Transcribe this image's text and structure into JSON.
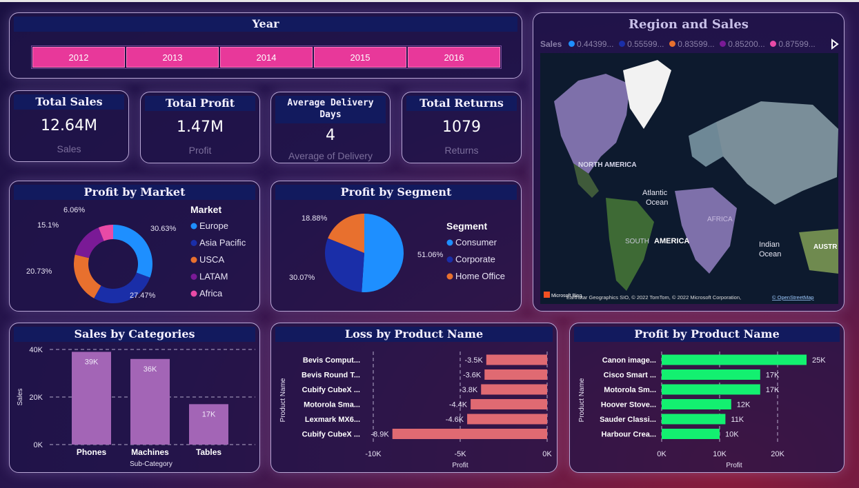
{
  "colors": {
    "slicer": "#e8389a",
    "europe": "#1e8fff",
    "asia_pacific": "#1a2ea8",
    "usca": "#e8702e",
    "latam": "#7a1a96",
    "africa": "#e84aa6",
    "category_bar": "#a365b6",
    "loss_bar": "#e06a72",
    "profit_bar": "#13f070"
  },
  "year_slicer": {
    "title": "Year",
    "years": [
      "2012",
      "2013",
      "2014",
      "2015",
      "2016"
    ]
  },
  "kpis": {
    "total_sales": {
      "title": "Total Sales",
      "value": "12.64M",
      "label": "Sales"
    },
    "total_profit": {
      "title": "Total Profit",
      "value": "1.47M",
      "label": "Profit"
    },
    "avg_delivery": {
      "title": "Average Delivery Days",
      "value": "4",
      "label": "Average of Delivery"
    },
    "total_returns": {
      "title": "Total Returns",
      "value": "1079",
      "label": "Returns"
    }
  },
  "map": {
    "title": "Region and Sales",
    "legend_title": "Sales",
    "legend_items": [
      "0.44399...",
      "0.55599...",
      "0.83599...",
      "0.85200...",
      "0.87599..."
    ],
    "legend_colors": [
      "#1e8fff",
      "#1a2ea8",
      "#e8702e",
      "#7a1a96",
      "#e84aa6"
    ],
    "labels": {
      "north_america": "NORTH AMERICA",
      "atlantic_1": "Atlantic",
      "atlantic_2": "Ocean",
      "africa": "AFRICA",
      "south_america_a": "SOUTH",
      "south_america_b": "AMERICA",
      "indian_1": "Indian",
      "indian_2": "Ocean",
      "australia": "AUSTR"
    },
    "attribution": "Microsoft Bing",
    "copyright": "Earthstar Geographics SIO, © 2022 TomTom, © 2022 Microsoft Corporation,",
    "osm_link": "© OpenStreetMap"
  },
  "chart_data": [
    {
      "type": "pie",
      "variant": "donut",
      "title": "Profit by Market",
      "legend_title": "Market",
      "legend_position": "right",
      "categories": [
        "Europe",
        "Asia Pacific",
        "USCA",
        "LATAM",
        "Africa"
      ],
      "values": [
        30.63,
        27.47,
        20.73,
        15.1,
        6.06
      ],
      "labels": [
        "30.63%",
        "27.47%",
        "20.73%",
        "15.1%",
        "6.06%"
      ]
    },
    {
      "type": "pie",
      "title": "Profit by Segment",
      "legend_title": "Segment",
      "legend_position": "right",
      "categories": [
        "Consumer",
        "Corporate",
        "Home Office"
      ],
      "values": [
        51.06,
        30.07,
        18.88
      ],
      "labels": [
        "51.06%",
        "30.07%",
        "18.88%"
      ]
    },
    {
      "type": "bar",
      "title": "Sales by Categories",
      "categories": [
        "Phones",
        "Machines",
        "Tables"
      ],
      "values": [
        39000,
        36000,
        17000
      ],
      "labels": [
        "39K",
        "36K",
        "17K"
      ],
      "xlabel": "Sub-Category",
      "ylabel": "Sales",
      "ylim": [
        0,
        40000
      ],
      "yticks": [
        "0K",
        "20K",
        "40K"
      ],
      "grid": true
    },
    {
      "type": "bar",
      "orientation": "horizontal",
      "title": "Loss by Product Name",
      "categories": [
        "Bevis Comput...",
        "Bevis Round T...",
        "Cubify CubeX ...",
        "Motorola Sma...",
        "Lexmark MX6...",
        "Cubify CubeX ..."
      ],
      "values": [
        -3500,
        -3600,
        -3800,
        -4400,
        -4600,
        -8900
      ],
      "labels": [
        "-3.5K",
        "-3.6K",
        "-3.8K",
        "-4.4K",
        "-4.6K",
        "-8.9K"
      ],
      "xlabel": "Profit",
      "ylabel": "Product Name",
      "xlim": [
        -10000,
        0
      ],
      "xticks": [
        "-10K",
        "-5K",
        "0K"
      ],
      "grid": true
    },
    {
      "type": "bar",
      "orientation": "horizontal",
      "title": "Profit by Product Name",
      "categories": [
        "Canon image...",
        "Cisco Smart ...",
        "Motorola Sm...",
        "Hoover Stove...",
        "Sauder Classi...",
        "Harbour Crea..."
      ],
      "values": [
        25000,
        17000,
        17000,
        12000,
        11000,
        10000
      ],
      "labels": [
        "25K",
        "17K",
        "17K",
        "12K",
        "11K",
        "10K"
      ],
      "xlabel": "Profit",
      "ylabel": "Product Name",
      "xlim": [
        0,
        25000
      ],
      "xticks": [
        "0K",
        "10K",
        "20K"
      ],
      "grid": true
    }
  ]
}
